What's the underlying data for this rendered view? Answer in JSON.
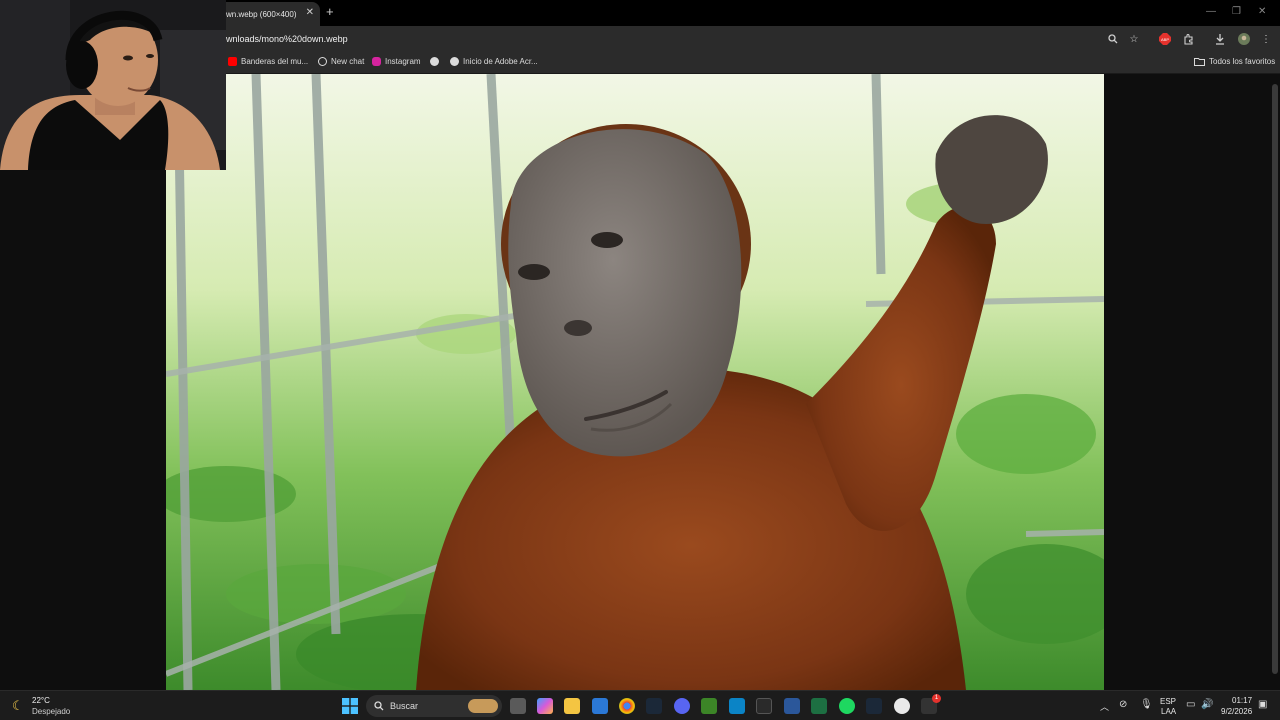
{
  "browser": {
    "tab_title": "wn.webp (600×400)",
    "close_glyph": "✕",
    "new_tab_glyph": "+",
    "url": "wnloads/mono%20down.webp",
    "bookmarks": [
      {
        "label": "Banderas del mu...",
        "icon": "youtube-icon"
      },
      {
        "label": "New chat",
        "icon": "openai-icon"
      },
      {
        "label": "Instagram",
        "icon": "instagram-icon"
      },
      {
        "label": "",
        "icon": "globe-icon"
      },
      {
        "label": "Inicio de Adobe Acr...",
        "icon": "globe-icon"
      }
    ],
    "favorites_label": "Todos los favoritos"
  },
  "image": {
    "description_icon": "orangutan-photo"
  },
  "taskbar": {
    "weather_temp": "22°C",
    "weather_desc": "Despejado",
    "search_placeholder": "Buscar",
    "lang_top": "ESP",
    "lang_bottom": "LAA",
    "time": "01:17",
    "date": "9/2/2026",
    "steam_badge": "1"
  },
  "colors": {
    "accent_red": "#e5322d",
    "instagram": "#d6249f",
    "spotify": "#1ed760",
    "excel": "#1d6f42",
    "word": "#2b579a"
  }
}
